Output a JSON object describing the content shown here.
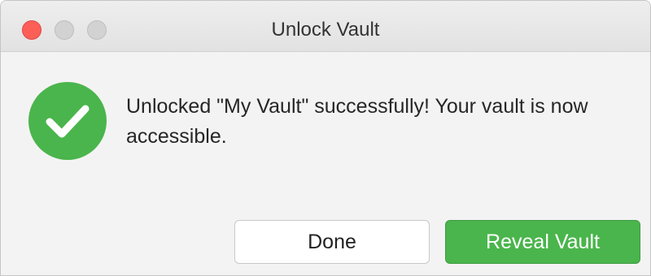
{
  "window": {
    "title": "Unlock Vault"
  },
  "dialog": {
    "status_icon": "checkmark-circle-icon",
    "message": "Unlocked \"My Vault\" successfully! Your vault is now accessible.",
    "buttons": {
      "done_label": "Done",
      "reveal_label": "Reveal Vault"
    }
  },
  "colors": {
    "success_green": "#4ab54c",
    "close_red": "#fc5f57",
    "inactive_gray": "#d2d2d2"
  }
}
